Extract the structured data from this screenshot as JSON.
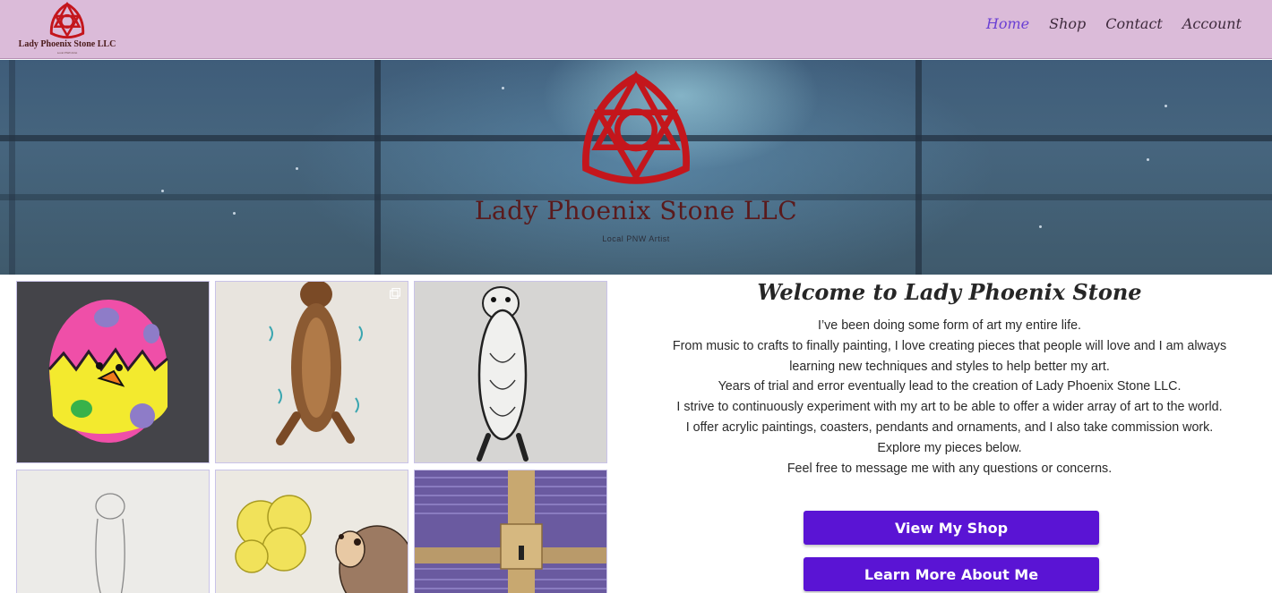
{
  "header": {
    "logo_name": "Lady Phoenix Stone LLC",
    "logo_tagline": "Local PNW Artist",
    "nav": [
      {
        "label": "Home",
        "active": true
      },
      {
        "label": "Shop",
        "active": false
      },
      {
        "label": "Contact",
        "active": false
      },
      {
        "label": "Account",
        "active": false
      }
    ]
  },
  "hero": {
    "title": "Lady Phoenix Stone LLC",
    "tagline": "Local PNW Artist"
  },
  "gallery": {
    "items": [
      {
        "subject": "painted easter egg chick rock"
      },
      {
        "subject": "brown otter drawing"
      },
      {
        "subject": "black ink otter drawing"
      },
      {
        "subject": "pencil sketch otter"
      },
      {
        "subject": "hedgehog with yellow flowers drawing"
      },
      {
        "subject": "purple woven box with wooden latch"
      }
    ]
  },
  "welcome": {
    "title": "Welcome to Lady Phoenix Stone",
    "paragraphs": [
      "I’ve been doing some form of art my entire life.",
      "From music to crafts to finally painting, I love creating pieces that people will love and I am always learning new techniques and styles to help better my art.",
      "Years of trial and error eventually lead to the creation of Lady Phoenix Stone LLC.",
      "I strive to continuously experiment with my art to be able to offer a wider array of art to the world.",
      "I offer acrylic paintings, coasters, pendants and ornaments, and I also take commission work.",
      "Explore my pieces below.",
      "Feel free to message me with any questions or concerns."
    ],
    "shop_button": "View My Shop",
    "about_button": "Learn More About Me"
  },
  "colors": {
    "header_bg": "#dbbbd9",
    "nav_active": "#6a3fd4",
    "logo_red": "#c4161c",
    "button_bg": "#5a14d4"
  }
}
